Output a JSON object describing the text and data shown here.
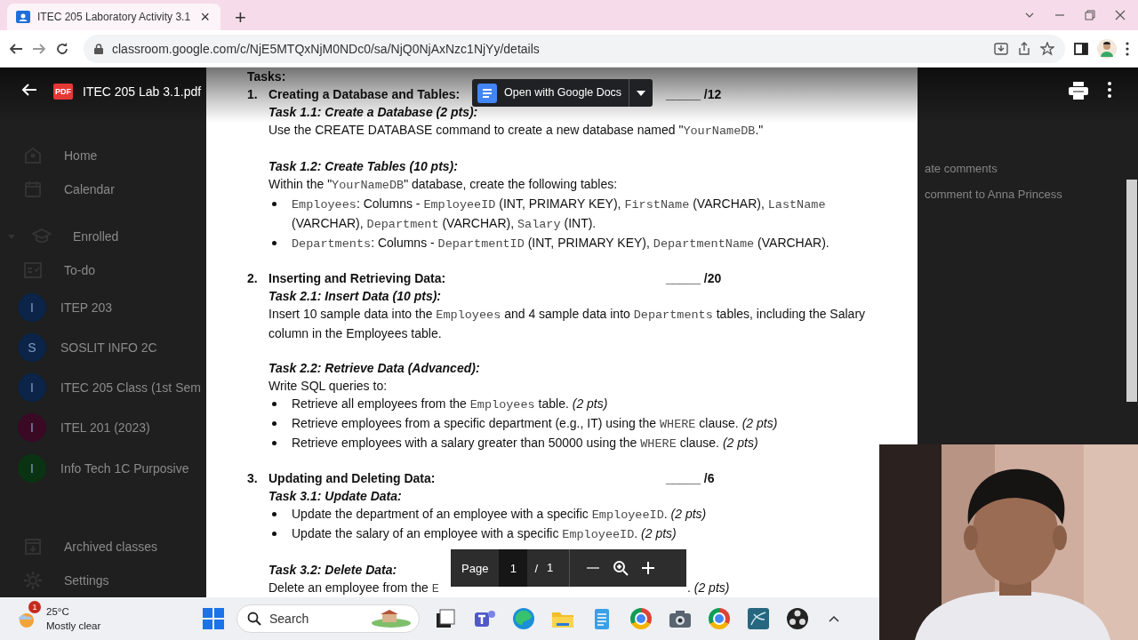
{
  "browser": {
    "tab": {
      "title": "ITEC 205 Laboratory Activity 3.1",
      "close": "×"
    },
    "new_tab": "+",
    "url": "classroom.google.com/c/NjE5MTQxNjM0NDc0/sa/NjQ0NjAxNzc1NjYy/details"
  },
  "sidebar": {
    "top": [
      {
        "label": "Home"
      },
      {
        "label": "Calendar"
      }
    ],
    "enrolled": {
      "label": "Enrolled",
      "expanded": true
    },
    "todo": {
      "label": "To-do"
    },
    "classes": [
      {
        "initial": "I",
        "name": "ITEP 203",
        "color": "#0b2447"
      },
      {
        "initial": "S",
        "name": "SOSLIT INFO 2C",
        "color": "#0b2447"
      },
      {
        "initial": "I",
        "name": "ITEC 205 Class (1st Sem",
        "color": "#0b2447"
      },
      {
        "initial": "I",
        "name": "ITEL 201 (2023)",
        "color": "#3a0a24"
      },
      {
        "initial": "I",
        "name": "Info Tech 1C Purposive",
        "color": "#0a3313"
      }
    ],
    "bottom": [
      {
        "label": "Archived classes"
      },
      {
        "label": "Settings"
      }
    ]
  },
  "right_panel": {
    "lines": [
      "ate comments",
      "comment to Anna Princess"
    ]
  },
  "pdf_viewer": {
    "file_name": "ITEC 205 Lab 3.1.pdf",
    "file_badge": "PDF",
    "open_button": "Open with Google Docs",
    "page_bar": {
      "label": "Page",
      "page": "1",
      "separator": "/",
      "total": "1"
    }
  },
  "document": {
    "tasks_label": "Tasks:",
    "sections": [
      {
        "number": "1.",
        "title": "Creating a Database and Tables:",
        "score": "_____ /12",
        "blocks": [
          {
            "kind": "task",
            "parts": [
              {
                "t": "Task 1.1: Create a Database (2 pts):",
                "kind": "text"
              }
            ]
          },
          {
            "kind": "para",
            "parts": [
              {
                "t": "Use the CREATE DATABASE command to create a new database named \"",
                "kind": "text"
              },
              {
                "t": "YourNameDB",
                "kind": "code"
              },
              {
                "t": ".\"",
                "kind": "text"
              }
            ]
          },
          {
            "kind": "task",
            "parts": [
              {
                "t": "Task 1.2: Create Tables (10 pts):",
                "kind": "text"
              }
            ]
          },
          {
            "kind": "para",
            "parts": [
              {
                "t": "Within the \"",
                "kind": "text"
              },
              {
                "t": "YourNameDB",
                "kind": "code"
              },
              {
                "t": "\" database, create the following tables:",
                "kind": "text"
              }
            ]
          },
          {
            "kind": "bullet",
            "parts": [
              {
                "t": "Employees",
                "kind": "code"
              },
              {
                "t": ": Columns - ",
                "kind": "text"
              },
              {
                "t": "EmployeeID",
                "kind": "code"
              },
              {
                "t": " (INT, PRIMARY KEY), ",
                "kind": "text"
              },
              {
                "t": "FirstName",
                "kind": "code"
              },
              {
                "t": " (VARCHAR), ",
                "kind": "text"
              },
              {
                "t": "LastName",
                "kind": "code"
              },
              {
                "t": " (VARCHAR), ",
                "kind": "text"
              },
              {
                "t": "Department",
                "kind": "code"
              },
              {
                "t": " (VARCHAR), ",
                "kind": "text"
              },
              {
                "t": "Salary",
                "kind": "code"
              },
              {
                "t": " (INT).",
                "kind": "text"
              }
            ]
          },
          {
            "kind": "bullet",
            "parts": [
              {
                "t": "Departments",
                "kind": "code"
              },
              {
                "t": ": Columns - ",
                "kind": "text"
              },
              {
                "t": "DepartmentID",
                "kind": "code"
              },
              {
                "t": " (INT, PRIMARY KEY), ",
                "kind": "text"
              },
              {
                "t": "DepartmentName",
                "kind": "code"
              },
              {
                "t": " (VARCHAR).",
                "kind": "text"
              }
            ]
          }
        ]
      },
      {
        "number": "2.",
        "title": "Inserting and Retrieving Data:",
        "score": "_____ /20",
        "blocks": [
          {
            "kind": "task",
            "parts": [
              {
                "t": "Task 2.1: Insert Data (10 pts):",
                "kind": "text"
              }
            ]
          },
          {
            "kind": "para",
            "parts": [
              {
                "t": "Insert 10 sample data into the ",
                "kind": "text"
              },
              {
                "t": "Employees",
                "kind": "code"
              },
              {
                "t": " and 4 sample data into ",
                "kind": "text"
              },
              {
                "t": "Departments",
                "kind": "code"
              },
              {
                "t": " tables, including the Salary column in the Employees table.",
                "kind": "text"
              }
            ]
          },
          {
            "kind": "task",
            "parts": [
              {
                "t": "Task 2.2: Retrieve Data (Advanced):",
                "kind": "text"
              }
            ]
          },
          {
            "kind": "para",
            "parts": [
              {
                "t": "Write SQL queries to:",
                "kind": "text"
              }
            ]
          },
          {
            "kind": "bullet",
            "parts": [
              {
                "t": "Retrieve all employees from the ",
                "kind": "text"
              },
              {
                "t": "Employees",
                "kind": "code"
              },
              {
                "t": " table. ",
                "kind": "text"
              },
              {
                "t": "(2 pts)",
                "kind": "italic"
              }
            ]
          },
          {
            "kind": "bullet",
            "parts": [
              {
                "t": "Retrieve employees from a specific department (e.g., IT) using the ",
                "kind": "text"
              },
              {
                "t": "WHERE",
                "kind": "code"
              },
              {
                "t": " clause. ",
                "kind": "text"
              },
              {
                "t": "(2 pts)",
                "kind": "italic"
              }
            ]
          },
          {
            "kind": "bullet",
            "parts": [
              {
                "t": "Retrieve employees with a salary greater than 50000 using the ",
                "kind": "text"
              },
              {
                "t": "WHERE",
                "kind": "code"
              },
              {
                "t": " clause. ",
                "kind": "text"
              },
              {
                "t": "(2 pts)",
                "kind": "italic"
              }
            ]
          }
        ]
      },
      {
        "number": "3.",
        "title": "Updating and Deleting Data:",
        "score": "_____ /6",
        "blocks": [
          {
            "kind": "task",
            "parts": [
              {
                "t": "Task 3.1: Update Data:",
                "kind": "text"
              }
            ]
          },
          {
            "kind": "bullet",
            "parts": [
              {
                "t": "Update the department of an employee with a specific ",
                "kind": "text"
              },
              {
                "t": "EmployeeID",
                "kind": "code"
              },
              {
                "t": ". ",
                "kind": "text"
              },
              {
                "t": "(2 pts)",
                "kind": "italic"
              }
            ]
          },
          {
            "kind": "bullet",
            "parts": [
              {
                "t": "Update the salary of an employee with a specific ",
                "kind": "text"
              },
              {
                "t": "EmployeeID",
                "kind": "code"
              },
              {
                "t": ". ",
                "kind": "text"
              },
              {
                "t": "(2 pts)",
                "kind": "italic"
              }
            ]
          },
          {
            "kind": "task",
            "parts": [
              {
                "t": "Task 3.2: Delete Data:",
                "kind": "text"
              }
            ]
          },
          {
            "kind": "covered",
            "parts": [
              {
                "t": "Delete an employee from the ",
                "kind": "text"
              },
              {
                "t": "E",
                "kind": "code"
              }
            ],
            "tail": [
              {
                "t": ". ",
                "kind": "text"
              },
              {
                "t": "(2 pts)",
                "kind": "italic"
              }
            ]
          }
        ]
      }
    ]
  },
  "taskbar": {
    "weather": {
      "badge": "1",
      "temperature": "25°C",
      "condition": "Mostly clear"
    },
    "search": {
      "placeholder": "Search"
    }
  }
}
